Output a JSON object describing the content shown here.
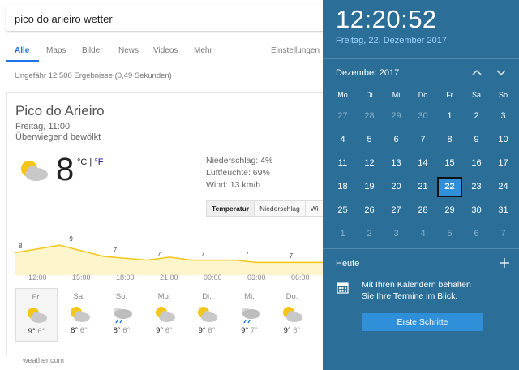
{
  "search": {
    "query": "pico do arieiro wetter"
  },
  "nav": {
    "tabs": [
      "Alle",
      "Maps",
      "Bilder",
      "News",
      "Videos",
      "Mehr"
    ],
    "settings": "Einstellungen"
  },
  "results": {
    "stats": "Ungefähr 12.500 Ergebnisse (0,49 Sekunden)"
  },
  "weather": {
    "location": "Pico do Arieiro",
    "time": "Freitag, 11:00",
    "condition": "Überwiegend bewölkt",
    "temp": "8",
    "unit_c": "°C",
    "unit_sep": " | ",
    "unit_f": "°F",
    "details": {
      "precip": "Niederschlag: 4%",
      "humidity": "Luftfeuchte: 69%",
      "wind": "Wind: 13 km/h"
    },
    "tabs": [
      "Temperatur",
      "Niederschlag",
      "Wi"
    ],
    "source": "weather.com",
    "chart_data": {
      "type": "area",
      "x": [
        "12:00",
        "15:00",
        "18:00",
        "21:00",
        "00:00",
        "03:00",
        "06:00"
      ],
      "labels": [
        {
          "pos": 0.0,
          "value": "8"
        },
        {
          "pos": 0.143,
          "value": "9"
        },
        {
          "pos": 0.286,
          "value": "7"
        },
        {
          "pos": 0.429,
          "value": "7"
        },
        {
          "pos": 0.571,
          "value": "7"
        },
        {
          "pos": 0.714,
          "value": "7"
        },
        {
          "pos": 0.857,
          "value": "7"
        }
      ],
      "points": [
        {
          "pos": 0.0,
          "value": 8
        },
        {
          "pos": 0.143,
          "value": 9
        },
        {
          "pos": 0.286,
          "value": 7.5
        },
        {
          "pos": 0.429,
          "value": 7
        },
        {
          "pos": 0.5,
          "value": 7.4
        },
        {
          "pos": 0.571,
          "value": 7
        },
        {
          "pos": 0.714,
          "value": 7
        },
        {
          "pos": 0.78,
          "value": 6.7
        },
        {
          "pos": 0.857,
          "value": 6.7
        },
        {
          "pos": 1.0,
          "value": 6.7
        }
      ],
      "ylim": [
        5,
        10
      ],
      "fill_color": "#fff5cc",
      "line_color": "#f5c518"
    },
    "days": [
      {
        "name": "Fr.",
        "icon": "partly-cloudy-icon",
        "hi": "9°",
        "lo": "6°"
      },
      {
        "name": "Sa.",
        "icon": "partly-cloudy-icon",
        "hi": "8°",
        "lo": "6°"
      },
      {
        "name": "So.",
        "icon": "rain-cloud-icon",
        "hi": "8°",
        "lo": "6°"
      },
      {
        "name": "Mo.",
        "icon": "partly-cloudy-icon",
        "hi": "9°",
        "lo": "6°"
      },
      {
        "name": "Di.",
        "icon": "partly-cloudy-icon",
        "hi": "9°",
        "lo": "6°"
      },
      {
        "name": "Mi.",
        "icon": "rain-cloud-icon",
        "hi": "9°",
        "lo": "7°"
      },
      {
        "name": "Do.",
        "icon": "partly-cloudy-icon",
        "hi": "9°",
        "lo": "6°"
      },
      {
        "name": "",
        "icon": "partly-cloudy-icon",
        "hi": "",
        "lo": ""
      }
    ]
  },
  "flyout": {
    "time": "12:20:52",
    "date": "Freitag, 22. Dezember 2017",
    "month": "Dezember 2017",
    "dow": [
      "Mo",
      "Di",
      "Mi",
      "Do",
      "Fr",
      "Sa",
      "So"
    ],
    "weeks": [
      [
        {
          "d": "27",
          "o": true
        },
        {
          "d": "28",
          "o": true
        },
        {
          "d": "29",
          "o": true
        },
        {
          "d": "30",
          "o": true
        },
        {
          "d": "1"
        },
        {
          "d": "2"
        },
        {
          "d": "3"
        }
      ],
      [
        {
          "d": "4"
        },
        {
          "d": "5"
        },
        {
          "d": "6"
        },
        {
          "d": "7"
        },
        {
          "d": "8"
        },
        {
          "d": "9"
        },
        {
          "d": "10"
        }
      ],
      [
        {
          "d": "11"
        },
        {
          "d": "12"
        },
        {
          "d": "13"
        },
        {
          "d": "14"
        },
        {
          "d": "15"
        },
        {
          "d": "16"
        },
        {
          "d": "17"
        }
      ],
      [
        {
          "d": "18"
        },
        {
          "d": "19"
        },
        {
          "d": "20"
        },
        {
          "d": "21"
        },
        {
          "d": "22",
          "t": true
        },
        {
          "d": "23"
        },
        {
          "d": "24"
        }
      ],
      [
        {
          "d": "25"
        },
        {
          "d": "26"
        },
        {
          "d": "27"
        },
        {
          "d": "28"
        },
        {
          "d": "29"
        },
        {
          "d": "30"
        },
        {
          "d": "31"
        }
      ],
      [
        {
          "d": "1",
          "o": true
        },
        {
          "d": "2",
          "o": true
        },
        {
          "d": "3",
          "o": true
        },
        {
          "d": "4",
          "o": true
        },
        {
          "d": "5",
          "o": true
        },
        {
          "d": "6",
          "o": true
        },
        {
          "d": "7",
          "o": true
        }
      ]
    ],
    "agenda_heading": "Heute",
    "agenda_line1": "Mit Ihren Kalendern behalten",
    "agenda_line2": "Sie Ihre Termine im Blick.",
    "start_button": "Erste Schritte",
    "colors": {
      "background": "#2b6f98",
      "accent": "#2f8fd8",
      "date_link": "#9fd4ff"
    }
  }
}
